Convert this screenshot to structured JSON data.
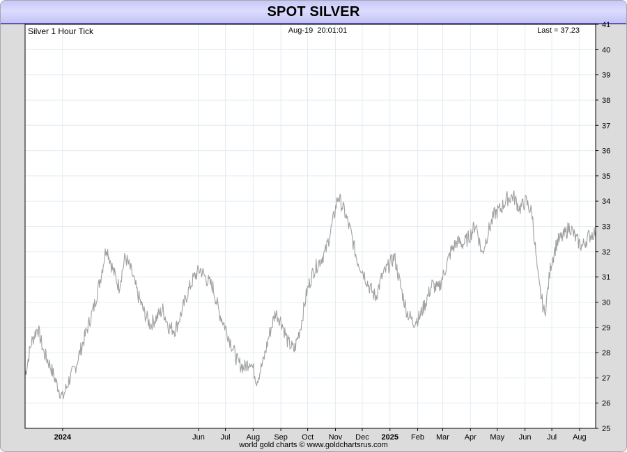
{
  "header": {
    "title": "SPOT SILVER"
  },
  "footer": {
    "credit": "world gold charts © www.goldchartsrus.com"
  },
  "chart_data": {
    "type": "line",
    "title": "SPOT SILVER",
    "subtitle_left": "Silver 1 Hour Tick",
    "subtitle_center": "Aug-19  20:01:01",
    "subtitle_right": "Last = 37.23",
    "y_axis_side": "right",
    "ylim": [
      25,
      41
    ],
    "y_ticks": [
      25,
      26,
      27,
      28,
      29,
      30,
      31,
      32,
      33,
      34,
      35,
      36,
      37,
      38,
      39,
      40,
      41
    ],
    "x_range": [
      "2023-11-20",
      "2025-08-19"
    ],
    "x_ticks": [
      {
        "label": "2024",
        "date": "2024-01-01",
        "bold": true
      },
      {
        "label": "Jun",
        "date": "2024-06-01"
      },
      {
        "label": "Jul",
        "date": "2024-07-01"
      },
      {
        "label": "Aug",
        "date": "2024-08-01"
      },
      {
        "label": "Sep",
        "date": "2024-09-01"
      },
      {
        "label": "Oct",
        "date": "2024-10-01"
      },
      {
        "label": "Nov",
        "date": "2024-11-01"
      },
      {
        "label": "Dec",
        "date": "2024-12-01"
      },
      {
        "label": "2025",
        "date": "2025-01-01",
        "bold": true
      },
      {
        "label": "Feb",
        "date": "2025-02-01"
      },
      {
        "label": "Mar",
        "date": "2025-03-01"
      },
      {
        "label": "Apr",
        "date": "2025-04-01"
      },
      {
        "label": "May",
        "date": "2025-05-01"
      },
      {
        "label": "Jun",
        "date": "2025-06-01"
      },
      {
        "label": "Jul",
        "date": "2025-07-01"
      },
      {
        "label": "Aug",
        "date": "2025-08-01"
      }
    ],
    "grid": true,
    "colors": {
      "line": "#a0a0a0",
      "grid": "#e2ecf2",
      "plot_border": "#000000"
    },
    "series": [
      {
        "values": [
          [
            "2023-11-20",
            27.1
          ],
          [
            "2023-11-27",
            28.4
          ],
          [
            "2023-12-04",
            29.0
          ],
          [
            "2023-12-11",
            28.0
          ],
          [
            "2023-12-18",
            27.5
          ],
          [
            "2023-12-25",
            26.8
          ],
          [
            "2024-01-01",
            26.2
          ],
          [
            "2024-01-08",
            26.9
          ],
          [
            "2024-01-15",
            27.4
          ],
          [
            "2024-01-22",
            28.2
          ],
          [
            "2024-01-29",
            29.0
          ],
          [
            "2024-02-05",
            29.8
          ],
          [
            "2024-02-12",
            30.9
          ],
          [
            "2024-02-19",
            32.2
          ],
          [
            "2024-02-26",
            31.3
          ],
          [
            "2024-03-04",
            30.6
          ],
          [
            "2024-03-11",
            31.8
          ],
          [
            "2024-03-18",
            31.2
          ],
          [
            "2024-03-25",
            30.3
          ],
          [
            "2024-04-01",
            29.6
          ],
          [
            "2024-04-08",
            29.1
          ],
          [
            "2024-04-15",
            29.4
          ],
          [
            "2024-04-22",
            29.7
          ],
          [
            "2024-04-29",
            29.0
          ],
          [
            "2024-05-06",
            28.9
          ],
          [
            "2024-05-13",
            29.6
          ],
          [
            "2024-05-20",
            30.4
          ],
          [
            "2024-05-27",
            31.0
          ],
          [
            "2024-06-03",
            31.3
          ],
          [
            "2024-06-10",
            30.9
          ],
          [
            "2024-06-17",
            30.6
          ],
          [
            "2024-06-24",
            29.6
          ],
          [
            "2024-07-01",
            29.0
          ],
          [
            "2024-07-08",
            28.3
          ],
          [
            "2024-07-15",
            27.6
          ],
          [
            "2024-07-22",
            27.4
          ],
          [
            "2024-07-29",
            27.7
          ],
          [
            "2024-08-05",
            26.9
          ],
          [
            "2024-08-12",
            27.6
          ],
          [
            "2024-08-19",
            28.7
          ],
          [
            "2024-08-26",
            29.6
          ],
          [
            "2024-09-02",
            29.2
          ],
          [
            "2024-09-09",
            28.4
          ],
          [
            "2024-09-16",
            28.1
          ],
          [
            "2024-09-23",
            29.0
          ],
          [
            "2024-09-30",
            30.4
          ],
          [
            "2024-10-07",
            31.2
          ],
          [
            "2024-10-14",
            31.6
          ],
          [
            "2024-10-21",
            32.0
          ],
          [
            "2024-10-28",
            33.0
          ],
          [
            "2024-11-04",
            34.2
          ],
          [
            "2024-11-11",
            33.6
          ],
          [
            "2024-11-18",
            32.8
          ],
          [
            "2024-11-25",
            31.7
          ],
          [
            "2024-12-02",
            31.2
          ],
          [
            "2024-12-09",
            30.6
          ],
          [
            "2024-12-16",
            30.2
          ],
          [
            "2024-12-23",
            31.0
          ],
          [
            "2024-12-30",
            31.4
          ],
          [
            "2025-01-06",
            31.8
          ],
          [
            "2025-01-13",
            30.6
          ],
          [
            "2025-01-20",
            29.6
          ],
          [
            "2025-01-27",
            29.2
          ],
          [
            "2025-02-03",
            29.4
          ],
          [
            "2025-02-10",
            30.0
          ],
          [
            "2025-02-17",
            30.7
          ],
          [
            "2025-02-24",
            30.5
          ],
          [
            "2025-03-03",
            31.2
          ],
          [
            "2025-03-10",
            32.0
          ],
          [
            "2025-03-17",
            32.4
          ],
          [
            "2025-03-24",
            32.3
          ],
          [
            "2025-03-31",
            32.6
          ],
          [
            "2025-04-07",
            33.1
          ],
          [
            "2025-04-14",
            31.9
          ],
          [
            "2025-04-21",
            32.8
          ],
          [
            "2025-04-28",
            33.5
          ],
          [
            "2025-05-05",
            33.7
          ],
          [
            "2025-05-12",
            34.1
          ],
          [
            "2025-05-19",
            34.2
          ],
          [
            "2025-05-26",
            33.7
          ],
          [
            "2025-06-02",
            34.0
          ],
          [
            "2025-06-09",
            33.5
          ],
          [
            "2025-06-16",
            30.8
          ],
          [
            "2025-06-23",
            29.5
          ],
          [
            "2025-06-30",
            31.5
          ],
          [
            "2025-07-07",
            32.4
          ],
          [
            "2025-07-14",
            32.6
          ],
          [
            "2025-07-21",
            33.0
          ],
          [
            "2025-07-28",
            32.5
          ],
          [
            "2025-08-04",
            32.2
          ],
          [
            "2025-08-11",
            32.6
          ],
          [
            "2025-08-19",
            32.8
          ]
        ]
      }
    ]
  }
}
